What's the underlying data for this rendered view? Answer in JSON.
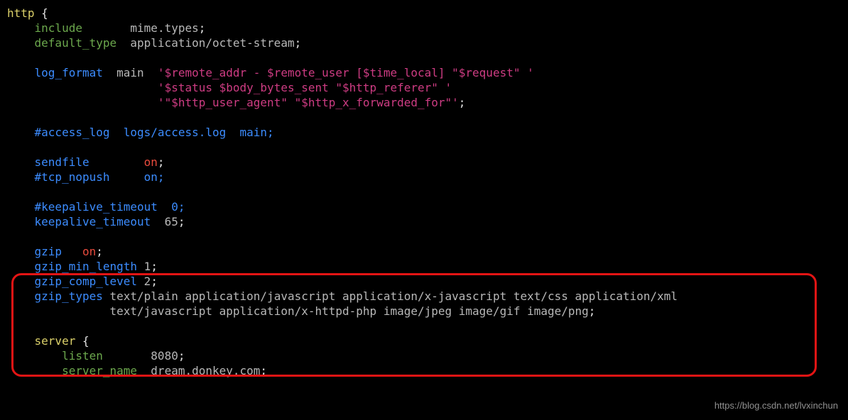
{
  "code": {
    "l1": {
      "http": "http",
      "brace": " {"
    },
    "l2": {
      "indent": "    ",
      "include": "include",
      "pad": "       ",
      "val": "mime.types",
      "semi": ";"
    },
    "l3": {
      "indent": "    ",
      "default_type": "default_type",
      "pad": "  ",
      "val": "application/octet-stream",
      "semi": ";"
    },
    "l5": {
      "indent": "    ",
      "log_format": "log_format",
      "main": "  main  ",
      "q1": "'",
      "str": "$remote_addr - $remote_user [$time_local] \"$request\" ",
      "q2": "'"
    },
    "l6": {
      "indent": "                      ",
      "q1": "'",
      "str": "$status $body_bytes_sent \"$http_referer\" ",
      "q2": "'"
    },
    "l7": {
      "indent": "                      ",
      "q1": "'",
      "str1": "\"$http_user_agent\" ",
      "str2": "\"$http_x_forwarded_for\"",
      "q2": "'",
      "semi": ";"
    },
    "l9": {
      "indent": "    ",
      "access": "#access_log  logs/access.log  main;"
    },
    "l11": {
      "indent": "    ",
      "sendfile": "sendfile",
      "pad": "        ",
      "on": "on",
      "semi": ";"
    },
    "l12": {
      "indent": "    ",
      "tcp": "#tcp_nopush     on;"
    },
    "l14": {
      "indent": "    ",
      "ka": "#keepalive_timeout  0;"
    },
    "l15": {
      "indent": "    ",
      "keep": "keepalive_timeout",
      "pad": "  ",
      "val": "65",
      "semi": ";"
    },
    "l17": {
      "indent": "    ",
      "gzip": "gzip",
      "pad": "   ",
      "on": "on",
      "semi": ";"
    },
    "l18": {
      "indent": "    ",
      "g": "gzip_min_length",
      "pad": " ",
      "val": "1",
      "semi": ";"
    },
    "l19": {
      "indent": "    ",
      "g": "gzip_comp_level",
      "pad": " ",
      "val": "2",
      "semi": ";"
    },
    "l20": {
      "indent": "    ",
      "g": "gzip_types",
      "pad": " ",
      "val1": "text/plain application/javascript application/x-javascript text/css application/xml"
    },
    "l21": {
      "indent": "               ",
      "val2": "text/javascript application/x-httpd-php image/jpeg image/gif image/png",
      "semi": ";"
    },
    "l23": {
      "indent": "    ",
      "server": "server",
      "brace": " {"
    },
    "l24": {
      "indent": "        ",
      "listen": "listen",
      "pad": "       ",
      "val": "8080",
      "semi": ";"
    },
    "l25": {
      "indent": "        ",
      "server_name": "server_name",
      "pad": "  ",
      "val": "dream.donkey.com",
      "semi": ";"
    }
  },
  "watermark": "https://blog.csdn.net/lvxinchun"
}
